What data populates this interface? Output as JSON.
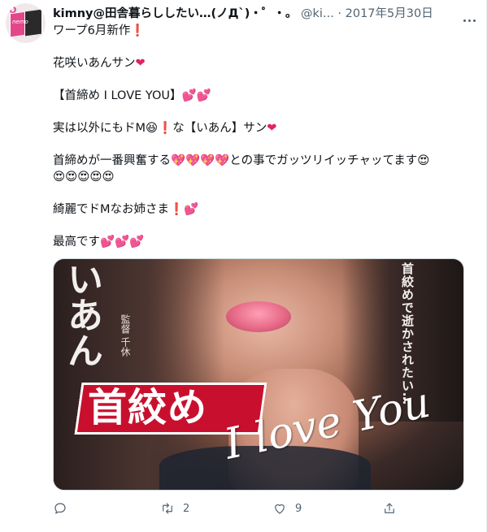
{
  "tweet": {
    "display_name": "kimny@田舎暮らししたい…(ノД`)・゜・。",
    "handle": "@ki...",
    "dot": "·",
    "date": "2017年5月30日",
    "lines": [
      "ワープ6月新作",
      "",
      "花咲いあんサン",
      "",
      "【首締め I LOVE YOU】",
      "",
      "実は以外にもドM",
      "",
      "首締めが一番興奮する",
      "",
      "",
      "綺麗でドMなお姉さま",
      "",
      "最高です"
    ],
    "line_parts": {
      "l1": "ワープ6月新作",
      "l2": "花咲いあんサン",
      "l3": "【首締め I LOVE YOU】",
      "l4a": "実は以外にもドM",
      "l4b": "な【いあん】サン",
      "l5a": "首締めが一番興奮する",
      "l5b": "との事でガッツリイッチャッてます",
      "l6": "綺麗でドMなお姉さま",
      "l7": "最高です"
    },
    "emoji": {
      "exclaim": "❗",
      "heart": "❤",
      "two_hearts": "💕",
      "sparkle_heart": "💖",
      "grin": "😆",
      "heart_eyes": "😍"
    }
  },
  "media": {
    "cover_name": "いあん",
    "director": "監督 千休",
    "slogan": "首絞めで逝かされたい…",
    "title_ja": "首絞め",
    "title_en": "I love You"
  },
  "actions": {
    "reply_count": "",
    "retweet_count": "2",
    "like_count": "9"
  },
  "colors": {
    "text": "#0f1419",
    "muted": "#536471",
    "heart": "#e0245e",
    "title_red": "#c8102e"
  },
  "icons": [
    "reply-icon",
    "retweet-icon",
    "like-icon",
    "share-icon",
    "more-icon"
  ]
}
